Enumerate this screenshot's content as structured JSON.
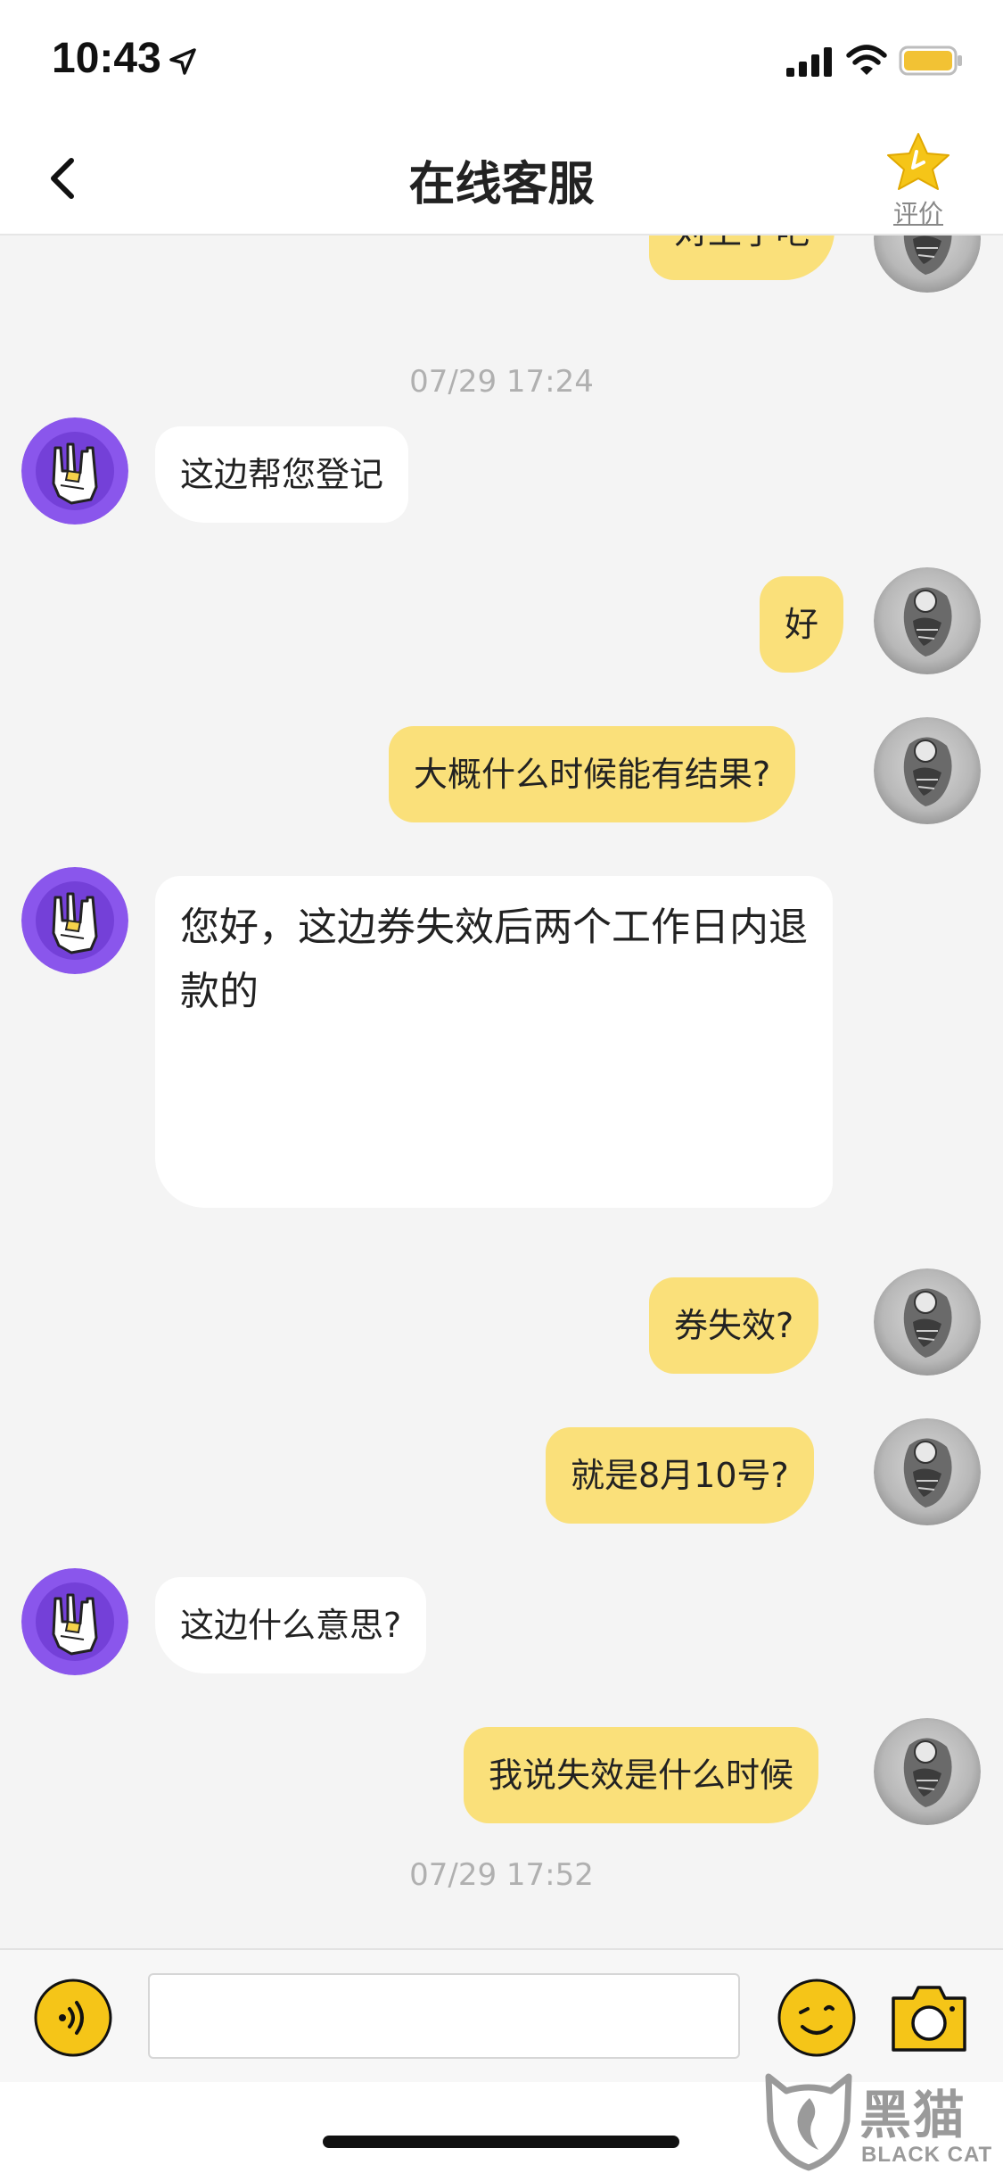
{
  "status_bar": {
    "time": "10:43"
  },
  "nav": {
    "title": "在线客服",
    "rate_label": "评价"
  },
  "chat": {
    "partial_top_message": "对上了吧",
    "timestamps": [
      "07/29 17:24",
      "07/29 17:52"
    ],
    "messages": [
      {
        "sender": "agent",
        "text": "这边帮您登记"
      },
      {
        "sender": "user",
        "text": "好"
      },
      {
        "sender": "user",
        "text": "大概什么时候能有结果?"
      },
      {
        "sender": "agent",
        "text": "您好，这边券失效后两个工作日内退款的"
      },
      {
        "sender": "user",
        "text": "券失效?"
      },
      {
        "sender": "user",
        "text": "就是8月10号?"
      },
      {
        "sender": "agent",
        "text": "这边什么意思?"
      },
      {
        "sender": "user",
        "text": "我说失效是什么时候"
      }
    ]
  },
  "input": {
    "value": ""
  },
  "watermark": {
    "cn": "黑猫",
    "en": "BLACK CAT"
  },
  "colors": {
    "user_bubble": "#fae07a",
    "agent_bubble": "#ffffff",
    "accent_yellow": "#f5c518",
    "agent_avatar": "#7b4fe0",
    "background": "#f4f4f4"
  }
}
